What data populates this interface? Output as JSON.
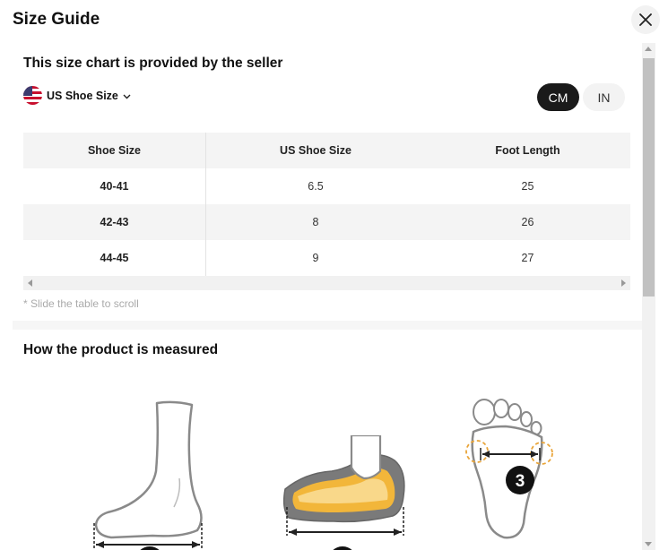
{
  "header": {
    "title": "Size Guide"
  },
  "size_chart": {
    "heading": "This size chart is provided by the seller",
    "size_system": {
      "selected": "US Shoe Size"
    },
    "units": {
      "cm": "CM",
      "in": "IN",
      "active": "CM"
    },
    "columns": [
      "Shoe Size",
      "US Shoe Size",
      "Foot Length"
    ],
    "rows": [
      [
        "40-41",
        "6.5",
        "25"
      ],
      [
        "42-43",
        "8",
        "26"
      ],
      [
        "44-45",
        "9",
        "27"
      ]
    ],
    "scroll_hint": "* Slide the table to scroll"
  },
  "measure": {
    "heading": "How the product is measured",
    "step3_label": "3"
  },
  "icons": {
    "close": "close-icon",
    "flag": "us-flag-icon",
    "chevron": "chevron-down-icon"
  },
  "colors": {
    "accent_dark": "#1a1a1a",
    "insole_yellow": "#f2b63a",
    "outline_gray": "#8a8a8a",
    "dashed_orange": "#e9a53a"
  }
}
